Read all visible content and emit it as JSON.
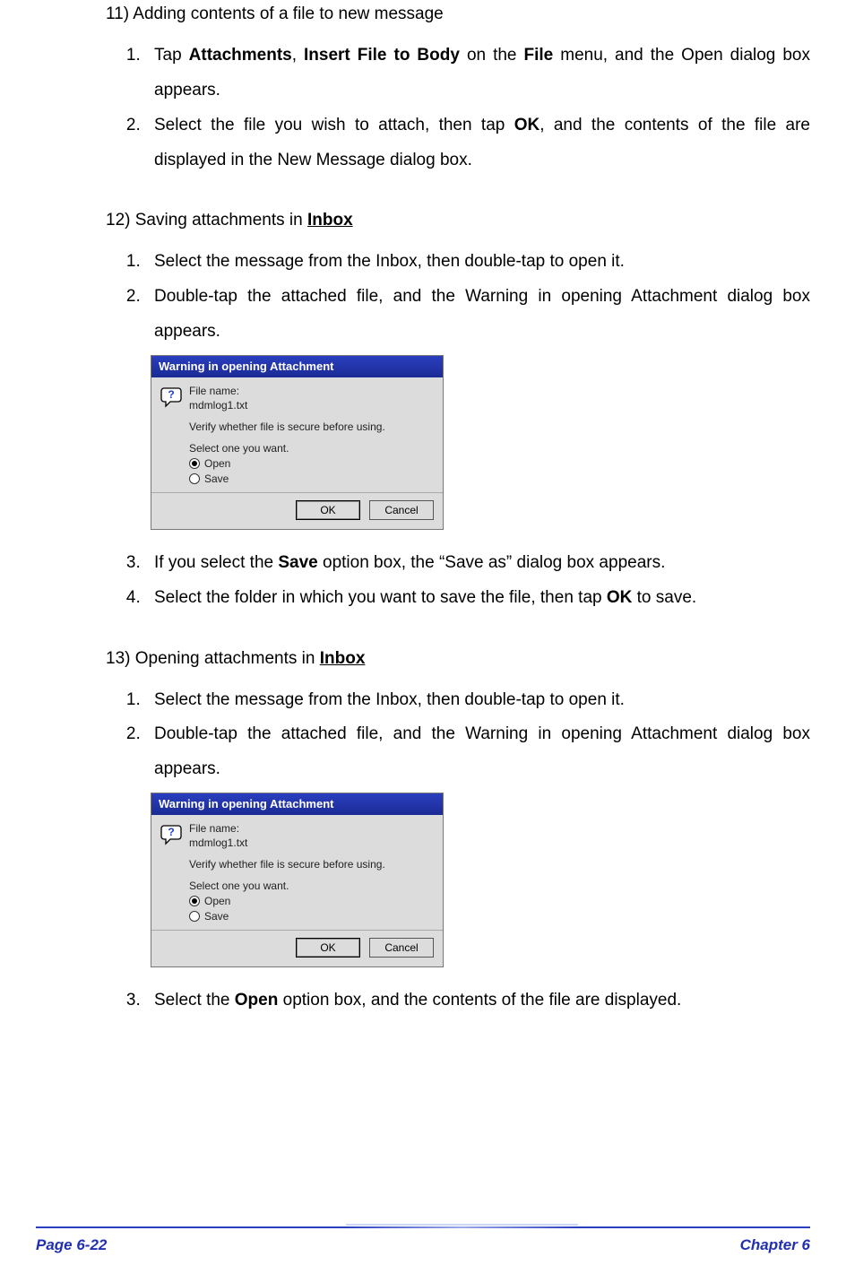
{
  "section11": {
    "title_prefix": "11)",
    "title_rest": " Adding contents of a file to new message",
    "steps": [
      {
        "parts": [
          {
            "t": "Tap "
          },
          {
            "t": "Attachments",
            "b": true
          },
          {
            "t": ", "
          },
          {
            "t": "Insert File to Body",
            "b": true
          },
          {
            "t": " on the "
          },
          {
            "t": "File",
            "b": true
          },
          {
            "t": " menu, and the Open dialog box appears."
          }
        ]
      },
      {
        "parts": [
          {
            "t": "Select the file you wish to attach, then tap "
          },
          {
            "t": "OK",
            "b": true
          },
          {
            "t": ", and the contents of the file are displayed in the New Message dialog box."
          }
        ]
      }
    ]
  },
  "section12": {
    "title_prefix": "12)",
    "title_rest_before": " Saving attachments in ",
    "title_inbox": "Inbox",
    "steps_a": [
      {
        "parts": [
          {
            "t": "Select the message from the Inbox, then double-tap to open it."
          }
        ]
      },
      {
        "parts": [
          {
            "t": "Double-tap the attached file, and the Warning in opening Attachment dialog box appears."
          }
        ]
      }
    ],
    "steps_b": [
      {
        "parts": [
          {
            "t": "If you select the "
          },
          {
            "t": "Save",
            "b": true
          },
          {
            "t": " option box, the “Save as” dialog box appears."
          }
        ]
      },
      {
        "parts": [
          {
            "t": "Select the folder in which you want to save the file, then tap "
          },
          {
            "t": "OK",
            "b": true
          },
          {
            "t": " to save."
          }
        ]
      }
    ]
  },
  "section13": {
    "title_prefix": "13)",
    "title_rest_before": " Opening attachments in ",
    "title_inbox": "Inbox",
    "steps_a": [
      {
        "parts": [
          {
            "t": "Select the message from the Inbox, then double-tap to open it."
          }
        ]
      },
      {
        "parts": [
          {
            "t": "Double-tap the attached file, and the Warning in opening Attachment dialog box appears."
          }
        ]
      }
    ],
    "steps_b": [
      {
        "parts": [
          {
            "t": "Select the "
          },
          {
            "t": "Open",
            "b": true
          },
          {
            "t": " option box, and the contents of the file are displayed."
          }
        ]
      }
    ]
  },
  "dialog": {
    "title": "Warning in opening Attachment",
    "file_label": "File name:",
    "file_value": "mdmlog1.txt",
    "verify": "Verify whether file is secure before using.",
    "select": "Select one you want.",
    "open": "Open",
    "save": "Save",
    "ok": "OK",
    "cancel": "Cancel"
  },
  "footer": {
    "left": "Page 6-22",
    "right": "Chapter 6"
  }
}
